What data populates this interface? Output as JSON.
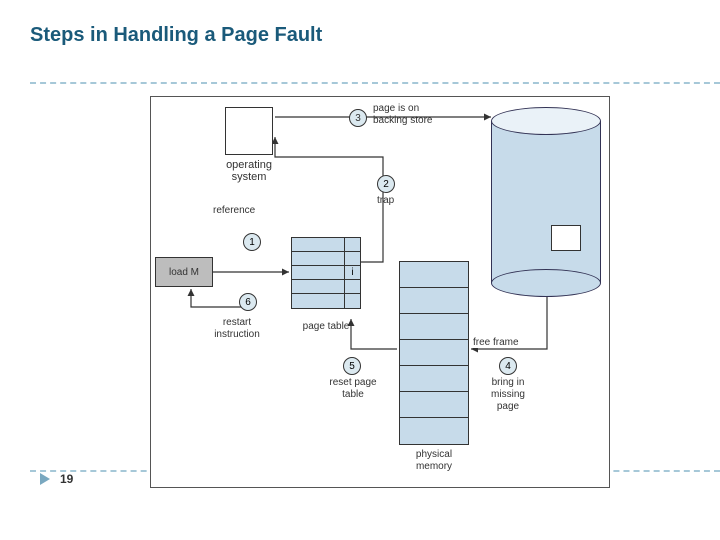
{
  "title": "Steps in Handling a Page Fault",
  "page_number": "19",
  "diagram": {
    "os_label": "operating\nsystem",
    "reference_label": "reference",
    "loadM_label": "load M",
    "page_table_label": "page table",
    "physical_memory_label": "physical\nmemory",
    "free_frame_label": "free frame",
    "invalid_bit": "i",
    "steps": {
      "s1": {
        "num": "1",
        "label": ""
      },
      "s2": {
        "num": "2",
        "label": "trap"
      },
      "s3": {
        "num": "3",
        "label": "page is on\nbacking store"
      },
      "s4": {
        "num": "4",
        "label": "bring in\nmissing\npage"
      },
      "s5": {
        "num": "5",
        "label": "reset page\ntable"
      },
      "s6": {
        "num": "6",
        "label": "restart\ninstruction"
      }
    }
  }
}
